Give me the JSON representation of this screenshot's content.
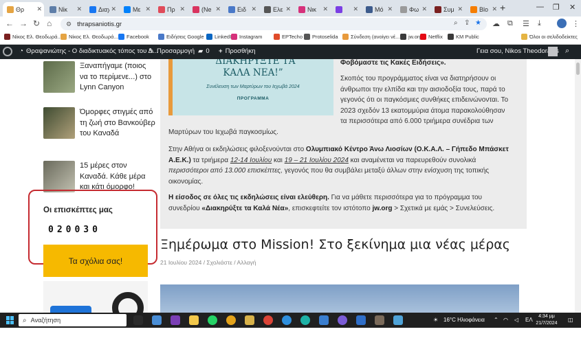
{
  "browser": {
    "tabs": [
      {
        "label": "Θρ",
        "favicon_color": "#e5a443",
        "active": true
      },
      {
        "label": "Νίκ",
        "favicon_color": "#5e7ea8",
        "active": false
      },
      {
        "label": "Διαχ",
        "favicon_color": "#1877f2",
        "active": false
      },
      {
        "label": "Με",
        "favicon_color": "#0081fb",
        "active": false
      },
      {
        "label": "Πρ",
        "favicon_color": "#e04b5a",
        "active": false
      },
      {
        "label": "(Ne",
        "favicon_color": "#d9345f",
        "active": false
      },
      {
        "label": "Ειδ",
        "favicon_color": "#4a79c8",
        "active": false
      },
      {
        "label": "Ελε",
        "favicon_color": "#555555",
        "active": false
      },
      {
        "label": "Νικ",
        "favicon_color": "#d6317b",
        "active": false
      },
      {
        "label": "",
        "favicon_color": "#7b3fe4",
        "active": false
      },
      {
        "label": "Μό",
        "favicon_color": "#3d5b8c",
        "active": false
      },
      {
        "label": "Φω",
        "favicon_color": "#9a9a9a",
        "active": false
      },
      {
        "label": "Συμ",
        "favicon_color": "#7a2020",
        "active": false
      },
      {
        "label": "Blo",
        "favicon_color": "#f57d00",
        "active": false
      }
    ],
    "new_tab": "+",
    "url": "thrapsaniotis.gr",
    "bookmarks": [
      {
        "label": "Νίκος Ελ. Θεοδωρά...",
        "favicon_color": "#7a2020"
      },
      {
        "label": "Νίκος Ελ. Θεοδωρά...",
        "favicon_color": "#e5a443"
      },
      {
        "label": "Facebook",
        "favicon_color": "#1877f2"
      },
      {
        "label": "Ειδήσεις Google",
        "favicon_color": "#4a79c8"
      },
      {
        "label": "LinkedIn",
        "favicon_color": "#0a66c2"
      },
      {
        "label": "Instagram",
        "favicon_color": "#d6317b"
      },
      {
        "label": "EPTecho",
        "favicon_color": "#e04b2a"
      },
      {
        "label": "Protoselida",
        "favicon_color": "#555555"
      },
      {
        "label": "Σύνδεση (ανοίγει νέ...",
        "favicon_color": "#e89a3c"
      },
      {
        "label": "jw.org",
        "favicon_color": "#3a3a3a"
      },
      {
        "label": "Netflix",
        "favicon_color": "#e50914"
      },
      {
        "label": "KM Public",
        "favicon_color": "#3a3a3a"
      },
      {
        "label": "Όλοι οι σελιδοδείκτες",
        "favicon_color": "#e5b443"
      }
    ]
  },
  "wp_admin": {
    "site_name": "Θραψανιώτης - Ο διαδικτυακός τόπος του Δ...",
    "customize": "Προσαρμογή",
    "comments_count": "0",
    "new": "Προσθήκη",
    "greeting": "Γεια σου, Nikos Theodorakis"
  },
  "sidebar": {
    "posts": [
      {
        "title": "Ξαναπήγαμε (ποιος να το περίμενε...) στο Lynn Canyon",
        "thumb_color": "#5d6b4a"
      },
      {
        "title": "Όμορφες στιγμές από τη ζωή στο Βανκούβερ του Καναδά",
        "thumb_color": "#4a5a3c"
      },
      {
        "title": "15 μέρες στον Καναδά. Κάθε μέρα και κάτι όμορφο!",
        "thumb_color": "#6a6a5c"
      }
    ],
    "visitors_title": "Οι επισκέπτες μας",
    "visitors_count": "020030",
    "comments_button": "Τα σχόλια σας!"
  },
  "article": {
    "banner_title_1": "“ΔΙΑΚΗΡΥΞΤΕ ΤΑ",
    "banner_title_2": "ΚΑΛΑ ΝΕΑ!”",
    "banner_subtitle": "Συνέλευση των Μαρτύρων του Ιεχωβά 2024",
    "banner_program": "ΠΡΟΓΡΑΜΜΑ",
    "p1_heading": "Φοβόμαστε τις Κακές Ειδήσεις».",
    "p1_lines": [
      "Σκοπός του προγράμματος είναι να διατηρήσουν οι",
      "άνθρωποι την ελπίδα και την αισιοδοξία τους, παρά το",
      "γεγονός ότι οι παγκόσμιες συνθήκες επιδεινώνονται. Το",
      "2023 σχεδόν 13 εκατομμύρια άτομα παρακολούθησαν",
      "τα περισσότερα από 6.000 τριήμερα συνέδρια των"
    ],
    "p1_end": "Μαρτύρων του Ιεχωβά παγκοσμίως.",
    "p2_a": "Στην Αθήνα οι εκδηλώσεις φιλοξενούνται στο ",
    "p2_b": "Ολυμπιακό Κέντρο Άνω Λιοσίων (Ο.Κ.Α.Λ. – Γήπεδο Μπάσκετ",
    "p2_c": "Α.Ε.Κ.)",
    "p2_d": " τα τριήμερα ",
    "p2_e": "12-14 Ιουλίου",
    "p2_f": " και ",
    "p2_g": "19 – 21 Ιουλίου 2024",
    "p2_h": " και αναμένεται να παρευρεθούν συνολικά",
    "p2_i": "περισσότεροι από 13.000 επισκέπτες,",
    "p2_j": " γεγονός που θα συμβάλει μεταξύ άλλων στην ενίσχυση της τοπικής",
    "p2_k": "οικονομίας.",
    "p3_a": "Η είσοδος σε όλες τις εκδηλώσεις είναι ελεύθερη.",
    "p3_b": " Για να μάθετε περισσότερα για το πρόγραμμα του",
    "p3_c": "συνεδρίου ",
    "p3_d": "«Διακηρύξτε τα Καλά Νέα»",
    "p3_e": ", επισκεφτείτε τον ιστότοπο ",
    "p3_f": "jw.org",
    "p3_g": " > Σχετικά με εμάς > Συνελεύσεις.",
    "next_post_title": "Ξημέρωμα στο Mission! Στο ξεκίνημα μια νέας μέρας",
    "next_post_meta": "21 Ιουλίου 2024 / Σχολιάστε / Αλλαγή"
  },
  "taskbar": {
    "search_placeholder": "Αναζήτηση",
    "weather": "16°C Ηλιοφάνεια",
    "language": "ΕΛ",
    "time": "4:34 μμ",
    "date": "21/7/2024"
  }
}
